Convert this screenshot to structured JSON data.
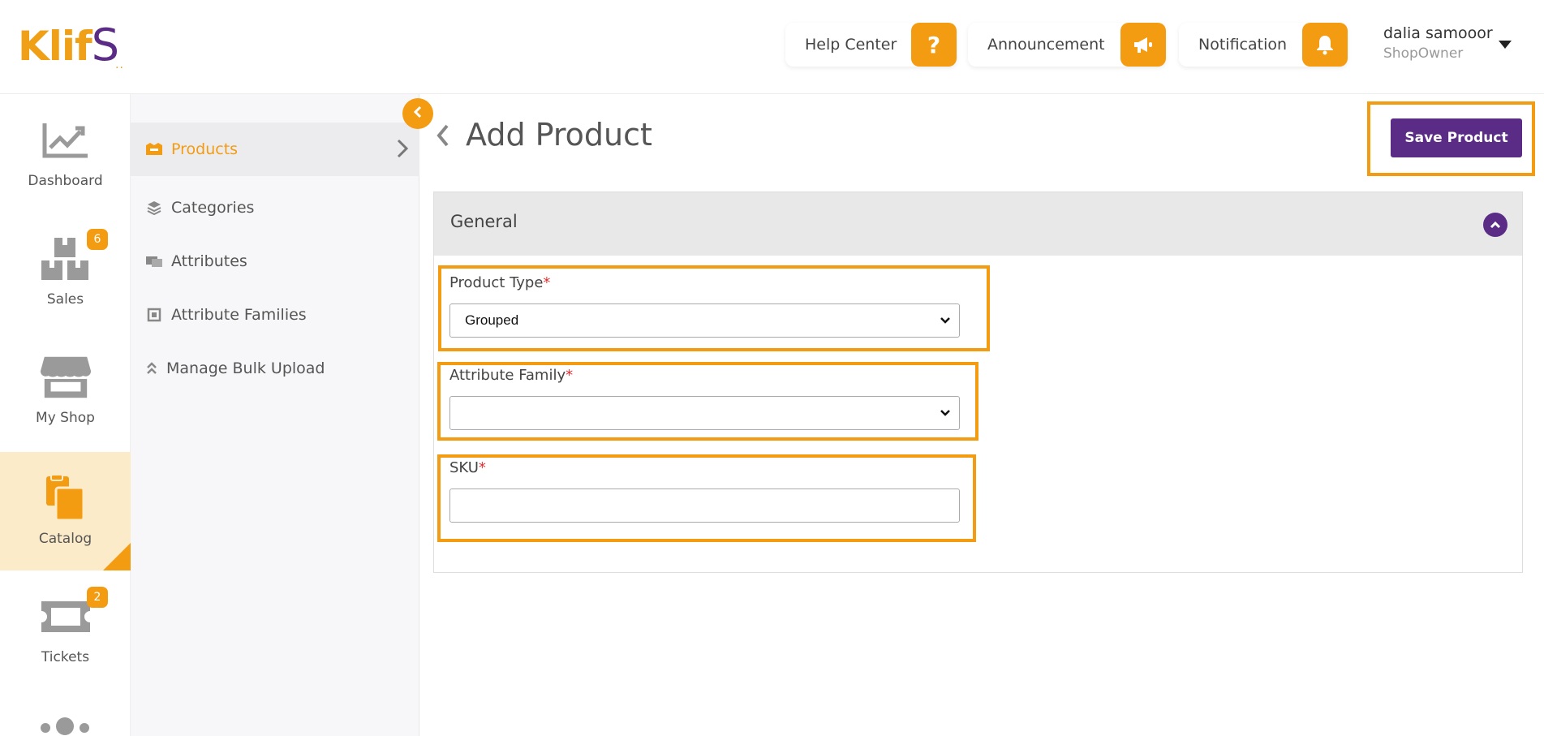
{
  "header": {
    "logo_text": "Klif",
    "logo_s": "S",
    "logo_dots": "..",
    "help_center_label": "Help Center",
    "announcement_label": "Announcement",
    "notification_label": "Notification",
    "user_name": "dalia samooor",
    "user_role": "ShopOwner"
  },
  "rail": {
    "items": [
      {
        "label": "Dashboard",
        "icon": "chart-icon"
      },
      {
        "label": "Sales",
        "icon": "boxes-icon",
        "badge": "6"
      },
      {
        "label": "My Shop",
        "icon": "store-icon"
      },
      {
        "label": "Catalog",
        "icon": "catalog-icon",
        "active": true
      },
      {
        "label": "Tickets",
        "icon": "ticket-icon",
        "badge": "2"
      }
    ]
  },
  "subnav": {
    "items": [
      {
        "label": "Products",
        "icon": "products-icon",
        "active": true
      },
      {
        "label": "Categories",
        "icon": "layers-icon"
      },
      {
        "label": "Attributes",
        "icon": "attributes-icon"
      },
      {
        "label": "Attribute Families",
        "icon": "families-icon"
      },
      {
        "label": "Manage Bulk Upload",
        "icon": "double-chevron-up-icon"
      }
    ]
  },
  "main": {
    "title": "Add Product",
    "save_label": "Save Product",
    "panel_title": "General",
    "product_type_label": "Product Type",
    "product_type_value": "Grouped",
    "attribute_family_label": "Attribute Family",
    "attribute_family_value": "",
    "sku_label": "SKU",
    "sku_value": "",
    "required_mark": "*"
  },
  "colors": {
    "accent": "#f39c12",
    "brand_purple": "#5a2c86",
    "required": "#e03030"
  }
}
